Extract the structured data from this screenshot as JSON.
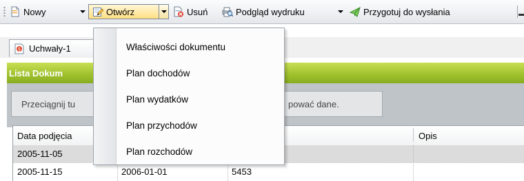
{
  "toolbar": {
    "nowy_label": "Nowy",
    "otworz_label": "Otwórz",
    "usun_label": "Usuń",
    "podglad_label": "Podgląd wydruku",
    "przygotuj_label": "Przygotuj do wysłania",
    "icons": {
      "nowy": "new-document-icon",
      "otworz": "edit-document-icon",
      "usun": "delete-document-icon",
      "podglad": "print-preview-icon",
      "przygotuj": "prepare-send-icon"
    }
  },
  "doc_tab": {
    "label": "Uchwały-1",
    "icon": "document-icon"
  },
  "panel": {
    "title": "Lista Dokum",
    "group_hint_start": "Przeciągnij tu",
    "group_hint_end": "pować dane."
  },
  "grid": {
    "columns": [
      "Data podjęcia",
      "",
      "",
      "Opis"
    ],
    "rows": [
      {
        "data_podjecia": "2005-11-05",
        "col2": "",
        "col3": "",
        "opis": ""
      },
      {
        "data_podjecia": "2005-11-15",
        "col2": "2006-01-01",
        "col3": "5453",
        "opis": ""
      }
    ]
  },
  "menu": {
    "items": [
      "Właściwości dokumentu",
      "Plan dochodów",
      "Plan wydatków",
      "Plan przychodów",
      "Plan rozchodów"
    ]
  },
  "colors": {
    "panel_header": "#9ec02d",
    "button_hot": "#ffdf83",
    "selected_row": "#dcdcdc"
  }
}
